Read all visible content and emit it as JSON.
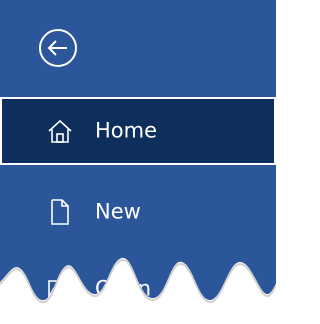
{
  "sidebar": {
    "back": {
      "icon": "back-arrow-circle-icon"
    },
    "items": [
      {
        "id": "home",
        "label": "Home",
        "icon": "home-icon",
        "active": true
      },
      {
        "id": "new",
        "label": "New",
        "icon": "new-document-icon",
        "active": false
      },
      {
        "id": "open",
        "label": "Open",
        "icon": "folder-open-icon",
        "active": false
      }
    ]
  },
  "colors": {
    "sidebar_bg": "#2b579a",
    "active_bg": "#0e2e5c",
    "text": "#ffffff",
    "page_bg": "#ffffff"
  }
}
